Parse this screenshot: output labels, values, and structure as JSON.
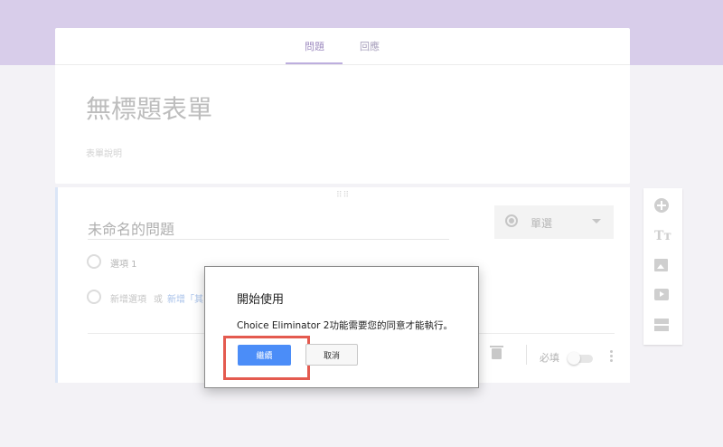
{
  "tabs": [
    {
      "label": "問題"
    },
    {
      "label": "回應"
    }
  ],
  "form": {
    "title": "無標題表單",
    "description": "表單說明"
  },
  "question": {
    "title": "未命名的問題",
    "type_label": "單選",
    "options": [
      {
        "label": "選項 1"
      }
    ],
    "add_option_label": "新增選項",
    "or_label": "或",
    "add_other_label": "新增「其",
    "required_label": "必填"
  },
  "toolbar": {
    "text_icon_glyph": "Tт"
  },
  "dialog": {
    "title": "開始使用",
    "message": "Choice Eliminator 2功能需要您的同意才能執行。",
    "continue_label": "繼續",
    "cancel_label": "取消"
  },
  "colors": {
    "header_band": "#d8cdea",
    "accent": "#a18fc2",
    "primary_button": "#4b8df8",
    "highlight_box": "#e45a4f"
  }
}
